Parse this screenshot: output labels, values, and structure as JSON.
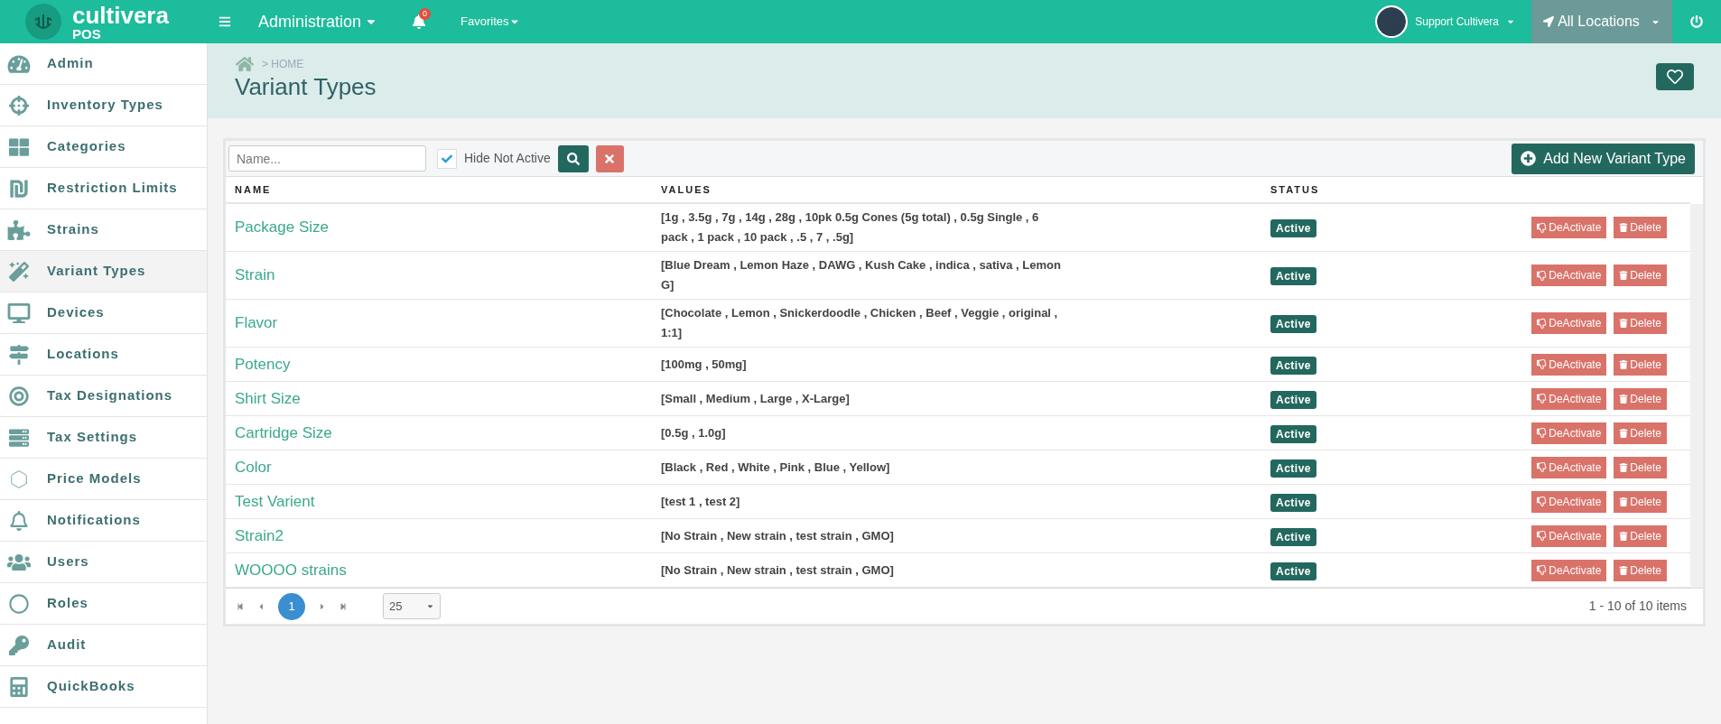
{
  "brand": {
    "name": "cultivera",
    "sub": "POS"
  },
  "topbar": {
    "module": "Administration",
    "notifications": "0",
    "favorites": "Favorites",
    "user": "Support Cultivera",
    "location": "All Locations"
  },
  "sidebar": {
    "items": [
      {
        "label": "Admin",
        "selected": false
      },
      {
        "label": "Inventory Types",
        "selected": false
      },
      {
        "label": "Categories",
        "selected": false
      },
      {
        "label": "Restriction Limits",
        "selected": false
      },
      {
        "label": "Strains",
        "selected": false
      },
      {
        "label": "Variant Types",
        "selected": true
      },
      {
        "label": "Devices",
        "selected": false
      },
      {
        "label": "Locations",
        "selected": false
      },
      {
        "label": "Tax Designations",
        "selected": false
      },
      {
        "label": "Tax Settings",
        "selected": false
      },
      {
        "label": "Price Models",
        "selected": false
      },
      {
        "label": "Notifications",
        "selected": false
      },
      {
        "label": "Users",
        "selected": false
      },
      {
        "label": "Roles",
        "selected": false
      },
      {
        "label": "Audit",
        "selected": false
      },
      {
        "label": "QuickBooks",
        "selected": false
      }
    ]
  },
  "breadcrumb": "> HOME",
  "page_title": "Variant Types",
  "toolbar": {
    "search_placeholder": "Name...",
    "hide_not_active": {
      "label": "Hide Not Active",
      "checked": true
    },
    "add_button": "Add New Variant Type"
  },
  "table": {
    "columns": [
      "NAME",
      "VALUES",
      "STATUS"
    ],
    "rows": [
      {
        "name": "Package Size",
        "values": "[1g , 3.5g , 7g , 14g , 28g , 10pk 0.5g Cones (5g total) , 0.5g Single , 6 pack , 1 pack , 10 pack , .5 , 7 , .5g]",
        "status": "Active",
        "deactivate": "DeActivate",
        "delete": "Delete"
      },
      {
        "name": "Strain",
        "values": "[Blue Dream , Lemon Haze , DAWG , Kush Cake , indica , sativa , Lemon G]",
        "status": "Active",
        "deactivate": "DeActivate",
        "delete": "Delete"
      },
      {
        "name": "Flavor",
        "values": "[Chocolate , Lemon , Snickerdoodle , Chicken , Beef , Veggie , original , 1:1]",
        "status": "Active",
        "deactivate": "DeActivate",
        "delete": "Delete"
      },
      {
        "name": "Potency",
        "values": "[100mg , 50mg]",
        "status": "Active",
        "deactivate": "DeActivate",
        "delete": "Delete"
      },
      {
        "name": "Shirt Size",
        "values": "[Small , Medium , Large , X-Large]",
        "status": "Active",
        "deactivate": "DeActivate",
        "delete": "Delete"
      },
      {
        "name": "Cartridge Size",
        "values": "[0.5g , 1.0g]",
        "status": "Active",
        "deactivate": "DeActivate",
        "delete": "Delete"
      },
      {
        "name": "Color",
        "values": "[Black , Red , White , Pink , Blue , Yellow]",
        "status": "Active",
        "deactivate": "DeActivate",
        "delete": "Delete"
      },
      {
        "name": "Test Varient",
        "values": "[test 1 , test 2]",
        "status": "Active",
        "deactivate": "DeActivate",
        "delete": "Delete"
      },
      {
        "name": "Strain2",
        "values": "[No Strain , New strain , test strain , GMO]",
        "status": "Active",
        "deactivate": "DeActivate",
        "delete": "Delete"
      },
      {
        "name": "WOOOO strains",
        "values": "[No Strain , New strain , test strain , GMO]",
        "status": "Active",
        "deactivate": "DeActivate",
        "delete": "Delete"
      }
    ]
  },
  "pager": {
    "pages": [
      {
        "label": "1",
        "selected": true
      }
    ],
    "page_size": "25",
    "summary": "1 - 10 of 10 items"
  }
}
